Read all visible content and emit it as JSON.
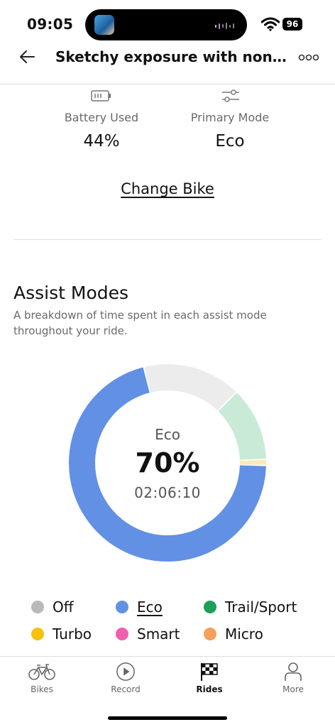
{
  "status_bar": {
    "time": "09:05",
    "battery": "96"
  },
  "header": {
    "title": "Sketchy exposure with none of..."
  },
  "stats": [
    {
      "icon": "battery-icon",
      "label": "Battery Used",
      "value": "44%"
    },
    {
      "icon": "sliders-icon",
      "label": "Primary Mode",
      "value": "Eco"
    }
  ],
  "change_bike": "Change Bike",
  "assist": {
    "title": "Assist Modes",
    "description": "A breakdown of time spent in each assist mode throughout your ride.",
    "center": {
      "mode": "Eco",
      "percent": "70%",
      "duration": "02:06:10"
    }
  },
  "chart_data": {
    "type": "pie",
    "title": "",
    "categories": [
      "Eco",
      "Off",
      "Trail/Sport",
      "Turbo"
    ],
    "values": [
      70,
      16,
      12,
      1
    ],
    "colors": {
      "Eco": "#6290e4",
      "Off": "#ececec",
      "Trail/Sport": "#c8ead6",
      "Turbo": "#fbeab8"
    }
  },
  "legend": [
    {
      "label": "Off",
      "color": "#b9b9b9",
      "selected": false
    },
    {
      "label": "Eco",
      "color": "#6290e4",
      "selected": true
    },
    {
      "label": "Trail/Sport",
      "color": "#1e9e5a",
      "selected": false
    },
    {
      "label": "Turbo",
      "color": "#f6c20f",
      "selected": false
    },
    {
      "label": "Smart",
      "color": "#ef5fae",
      "selected": false
    },
    {
      "label": "Micro",
      "color": "#f5a05c",
      "selected": false
    }
  ],
  "tabs": [
    {
      "icon": "bike-icon",
      "label": "Bikes",
      "active": false
    },
    {
      "icon": "play-icon",
      "label": "Record",
      "active": false
    },
    {
      "icon": "checkered-flag-icon",
      "label": "Rides",
      "active": true
    },
    {
      "icon": "person-icon",
      "label": "More",
      "active": false
    }
  ]
}
